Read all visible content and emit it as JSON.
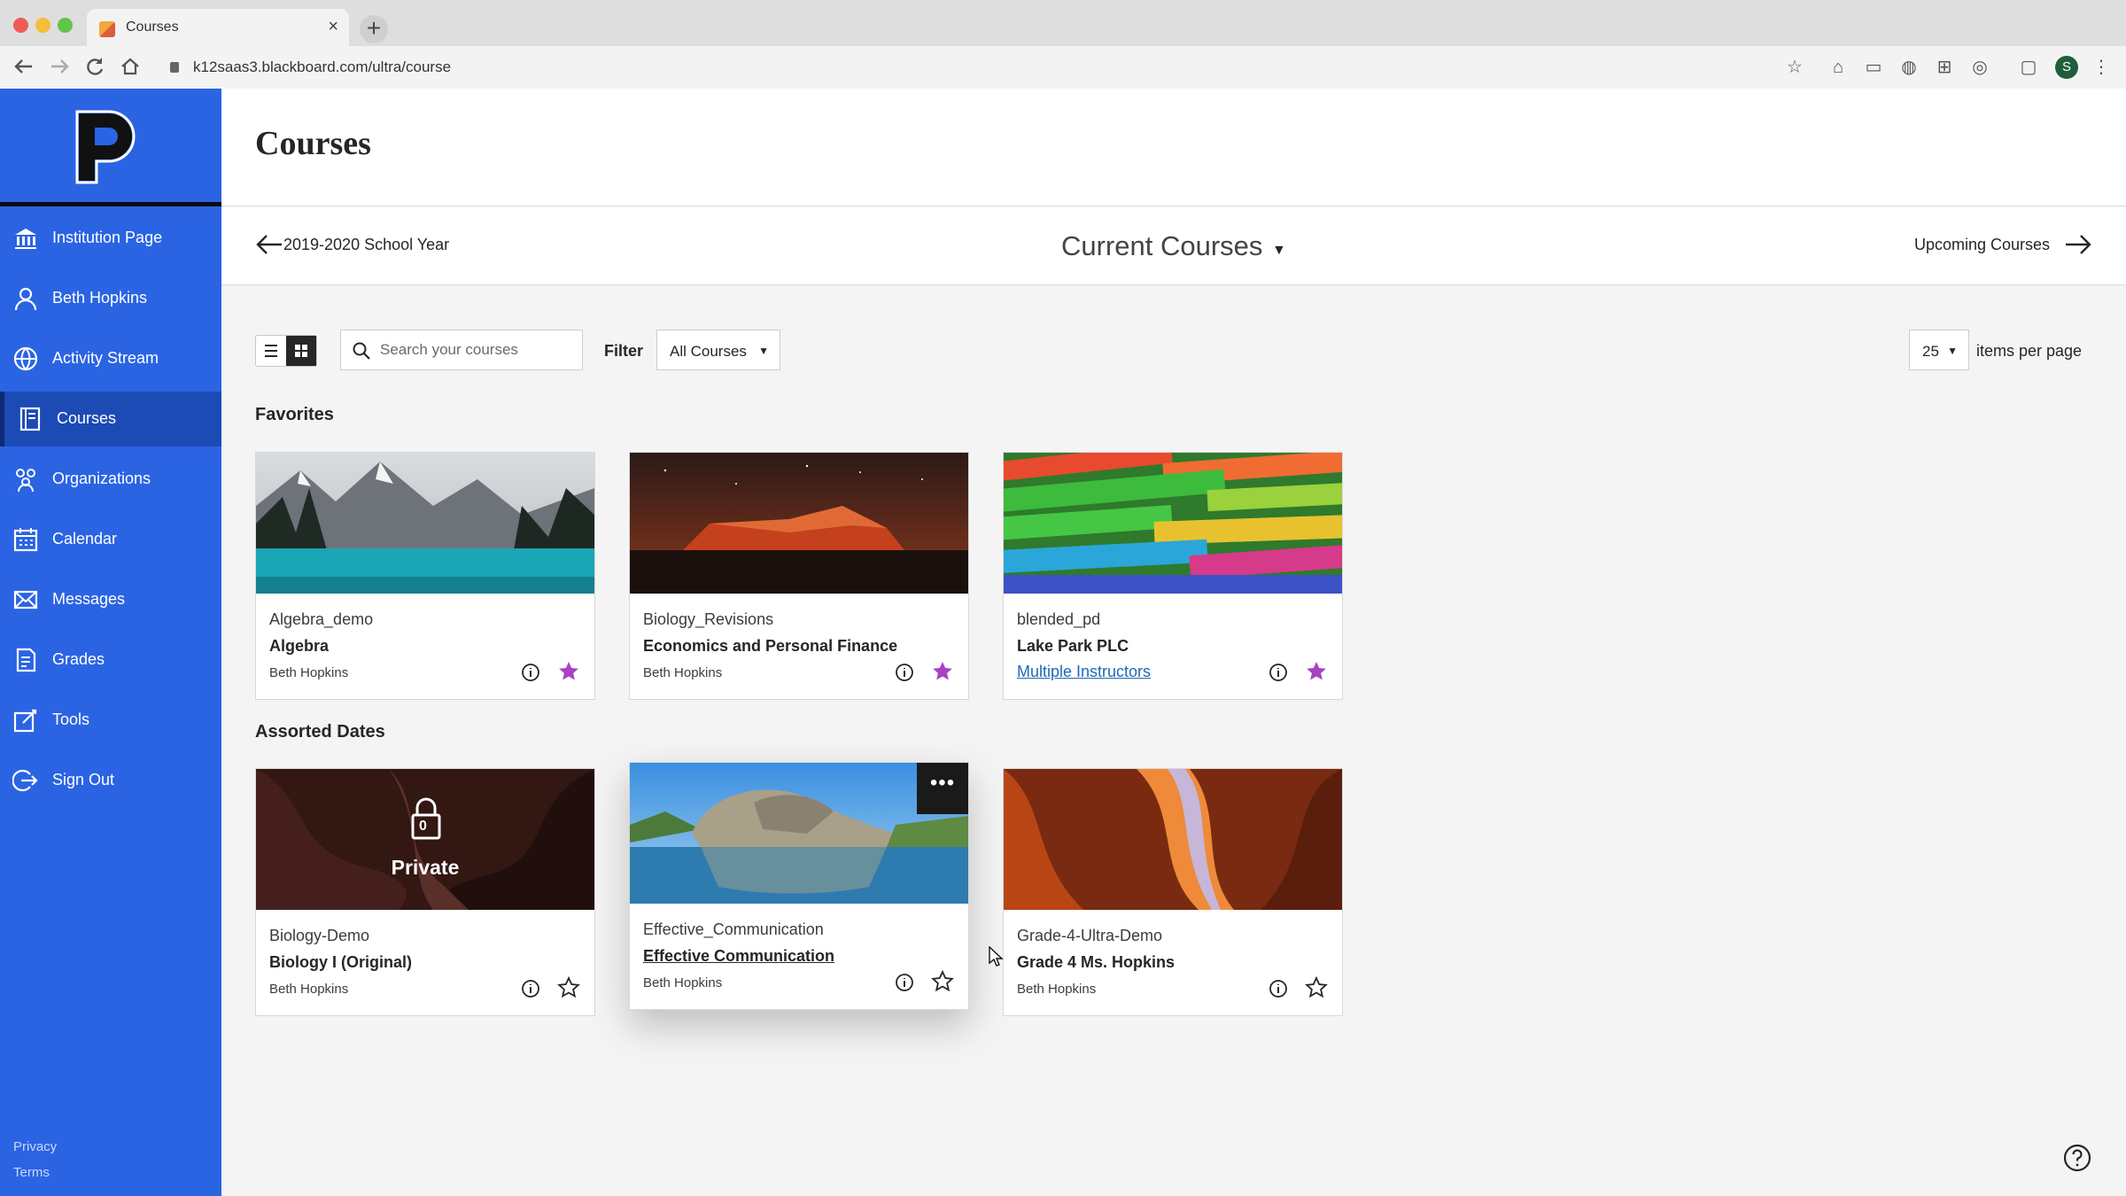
{
  "browser": {
    "tab_title": "Courses",
    "url": "k12saas3.blackboard.com/ultra/course",
    "profile_initial": "S",
    "new_tab_label": "+",
    "close_label": "×"
  },
  "sidebar": {
    "items": [
      {
        "label": "Institution Page",
        "icon": "institution-icon"
      },
      {
        "label": "Beth Hopkins",
        "icon": "person-icon"
      },
      {
        "label": "Activity Stream",
        "icon": "globe-icon"
      },
      {
        "label": "Courses",
        "icon": "courses-icon",
        "active": true
      },
      {
        "label": "Organizations",
        "icon": "organizations-icon"
      },
      {
        "label": "Calendar",
        "icon": "calendar-icon"
      },
      {
        "label": "Messages",
        "icon": "envelope-icon"
      },
      {
        "label": "Grades",
        "icon": "grades-icon"
      },
      {
        "label": "Tools",
        "icon": "tools-icon"
      },
      {
        "label": "Sign Out",
        "icon": "sign-out-icon"
      }
    ],
    "footer": {
      "privacy": "Privacy",
      "terms": "Terms"
    }
  },
  "main": {
    "title": "Courses",
    "term": {
      "previous": "2019-2020 School Year",
      "current": "Current Courses",
      "next": "Upcoming Courses"
    },
    "toolbar": {
      "search_placeholder": "Search your courses",
      "filter_label": "Filter",
      "filter_value": "All Courses",
      "per_page_value": "25",
      "per_page_label": "items per page"
    },
    "sections": [
      {
        "title": "Favorites",
        "courses": [
          {
            "id": "Algebra_demo",
            "name": "Algebra",
            "instructor": "Beth Hopkins",
            "favorite": true,
            "image": "mountain-lake"
          },
          {
            "id": "Biology_Revisions",
            "name": "Economics and Personal Finance",
            "instructor": "Beth Hopkins",
            "favorite": true,
            "image": "night-rock"
          },
          {
            "id": "blended_pd",
            "name": "Lake Park PLC",
            "instructor": "Multiple Instructors",
            "instructor_link": true,
            "favorite": true,
            "image": "chalk"
          }
        ]
      },
      {
        "title": "Assorted Dates",
        "courses": [
          {
            "id": "Biology-Demo",
            "name": "Biology I (Original)",
            "instructor": "Beth Hopkins",
            "favorite": false,
            "image": "canyon-dark",
            "private": true,
            "private_label": "Private",
            "private_count": "0"
          },
          {
            "id": "Effective_Communication",
            "name": "Effective Communication",
            "instructor": "Beth Hopkins",
            "favorite": false,
            "image": "rock-lake",
            "hovered": true,
            "more_label": "•••"
          },
          {
            "id": "Grade-4-Ultra-Demo",
            "name": "Grade 4 Ms. Hopkins",
            "instructor": "Beth Hopkins",
            "favorite": false,
            "image": "canyon-orange"
          }
        ]
      }
    ]
  },
  "colors": {
    "sidebar": "#2b64e3",
    "sidebar_active": "#1c4bb6",
    "favorite_star": "#a742c5",
    "link": "#1d6ab5"
  }
}
